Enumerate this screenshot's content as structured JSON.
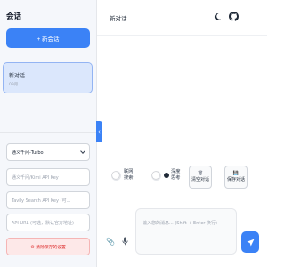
{
  "sidebar": {
    "title": "会话",
    "new_chat_label": "+ 新会话",
    "chats": [
      {
        "title": "新对话",
        "time": "09月"
      }
    ],
    "model_select": {
      "value": "通义千问-Turbo"
    },
    "kimi_key": {
      "placeholder": "通义千问/Kimi API Key"
    },
    "tavily_key": {
      "placeholder": "Tavily Search API Key (可..."
    },
    "api_url": {
      "placeholder": "API URL (可选，默认官方地址)"
    },
    "clear_settings_label": "⊗ 清除保存的设置"
  },
  "header": {
    "title": "新对话",
    "icons": [
      "moon-icon",
      "github-icon"
    ]
  },
  "toolbar": {
    "web_search_label": "联网搜索",
    "deep_think_label": "深度思考",
    "clear_chat_label": "清空对话",
    "save_chat_label": "保存对话"
  },
  "composer": {
    "placeholder": "输入您的消息... (Shift + Enter 换行)"
  },
  "colors": {
    "accent": "#3b82f6",
    "danger": "#dc2626",
    "selected_bg": "#dbe7fc"
  }
}
